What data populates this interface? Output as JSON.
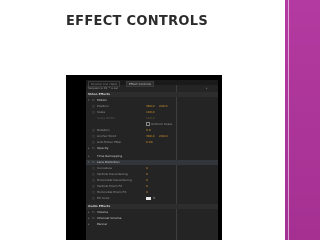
{
  "slide": {
    "title": "EFFECT CONTROLS",
    "accent_color": "#a53092"
  },
  "panel": {
    "tabs": [
      {
        "label": "Source: (no clips)",
        "active": false
      },
      {
        "label": "Effect Controls",
        "active": true
      }
    ],
    "clip_name": "Sequence 01 * a.avi",
    "video_effects_label": "Video Effects",
    "motion_label": "Motion",
    "position_label": "Position",
    "position_x": "360.0",
    "position_y": "240.0",
    "scale_label": "Scale",
    "scale_value": "100.0",
    "scale_width_label": "Scale Width",
    "scale_width_value": "100.0",
    "uniform_scale_label": "Uniform Scale",
    "rotation_label": "Rotation",
    "rotation_value": "0.0",
    "anchor_label": "Anchor Point",
    "anchor_x": "360.0",
    "anchor_y": "240.0",
    "antiflicker_label": "Anti-flicker Filter",
    "antiflicker_value": "0.00",
    "opacity_label": "Opacity",
    "time_remap_label": "Time Remapping",
    "lens_label": "Lens Distortion",
    "curvature_label": "Curvature",
    "curvature_value": "0",
    "v_decenter_label": "Vertical Decentering",
    "v_decenter_value": "0",
    "h_decenter_label": "Horizontal Decentering",
    "h_decenter_value": "0",
    "v_prism_label": "Vertical Prism FX",
    "v_prism_value": "0",
    "h_prism_label": "Horizontal Prism FX",
    "h_prism_value": "0",
    "fill_color_label": "Fill Color",
    "audio_effects_label": "Audio Effects",
    "volume_label": "Volume",
    "channel_volume_label": "Channel Volume",
    "panner_label": "Panner"
  }
}
